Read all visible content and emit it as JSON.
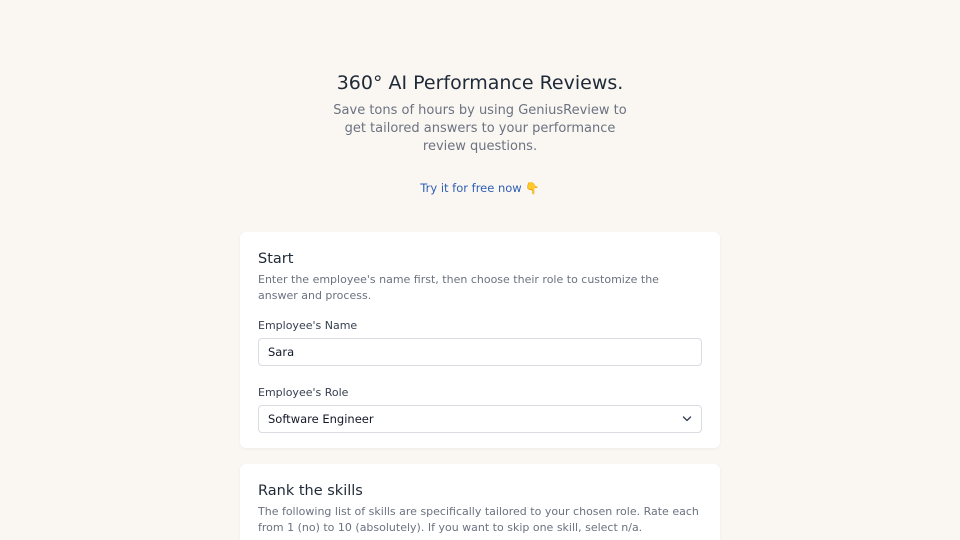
{
  "hero": {
    "title": "360° AI Performance Reviews.",
    "subtitle": "Save tons of hours by using GeniusReview to get tailored answers to your performance review questions.",
    "cta_label": "Try it for free now 👇"
  },
  "start_card": {
    "title": "Start",
    "description": "Enter the employee's name first, then choose their role to customize the answer and process.",
    "name_label": "Employee's Name",
    "name_value": "Sara",
    "role_label": "Employee's Role",
    "role_value": "Software Engineer"
  },
  "rank_card": {
    "title": "Rank the skills",
    "description": "The following list of skills are specifically tailored to your chosen role. Rate each from 1 (no) to 10 (absolutely). If you want to skip one skill, select n/a."
  },
  "icons": {
    "role_dropdown": "chevron-down-icon"
  },
  "colors": {
    "background": "#faf7f2",
    "card": "#ffffff",
    "link": "#2f5fb3",
    "muted_text": "#6b7280"
  }
}
